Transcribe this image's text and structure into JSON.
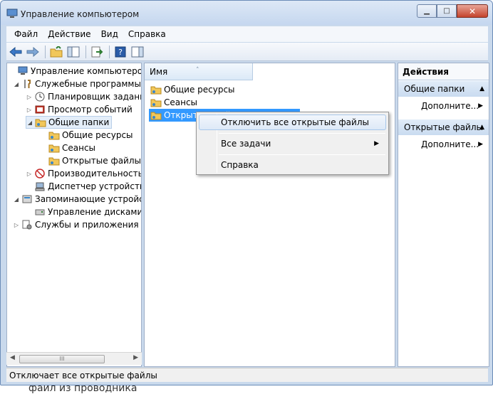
{
  "background_text": "файл из проводника",
  "window": {
    "title": "Управление компьютером",
    "min_glyph": "▁",
    "max_glyph": "□",
    "close_glyph": "✕"
  },
  "menu": [
    "Файл",
    "Действие",
    "Вид",
    "Справка"
  ],
  "tree": [
    {
      "label": "Управление компьютером (л",
      "expander": "",
      "icon": "computer-management-icon"
    },
    {
      "label": "Служебные программы",
      "expander": "◢",
      "icon": "tools-icon"
    },
    {
      "label": "Планировщик заданий",
      "expander": "▷",
      "icon": "clock-icon"
    },
    {
      "label": "Просмотр событий",
      "expander": "▷",
      "icon": "event-viewer-icon"
    },
    {
      "label": "Общие папки",
      "expander": "◢",
      "icon": "shared-folder-icon"
    },
    {
      "label": "Общие ресурсы",
      "expander": "",
      "icon": "shared-folder-icon"
    },
    {
      "label": "Сеансы",
      "expander": "",
      "icon": "shared-folder-icon"
    },
    {
      "label": "Открытые файлы",
      "expander": "",
      "icon": "shared-folder-icon"
    },
    {
      "label": "Производительность",
      "expander": "▷",
      "icon": "performance-icon"
    },
    {
      "label": "Диспетчер устройств",
      "expander": "",
      "icon": "device-manager-icon"
    },
    {
      "label": "Запоминающие устройст",
      "expander": "◢",
      "icon": "storage-icon"
    },
    {
      "label": "Управление дисками",
      "expander": "",
      "icon": "disk-icon"
    },
    {
      "label": "Службы и приложения",
      "expander": "▷",
      "icon": "services-icon"
    }
  ],
  "hscroll": {
    "left": "◀",
    "right": "▶",
    "thumb": "III"
  },
  "list": {
    "column_header": "Имя",
    "sort_caret": "˄",
    "items": [
      "Общие ресурсы",
      "Сеансы",
      "Открытые файлы"
    ]
  },
  "actions": {
    "title": "Действия",
    "sections": [
      {
        "label": "Общие папки",
        "link": "Дополните..."
      },
      {
        "label": "Открытые файлы",
        "link": "Дополните..."
      }
    ],
    "up_glyph": "▲",
    "link_arrow": "▶"
  },
  "context_menu": {
    "items": [
      "Отключить все открытые файлы",
      "Все задачи",
      "Справка"
    ],
    "submenu_arrow": "▶"
  },
  "status": "Отключает все открытые файлы",
  "colors": {
    "selection": "#3399ff",
    "accent": "#c9d9ec"
  }
}
